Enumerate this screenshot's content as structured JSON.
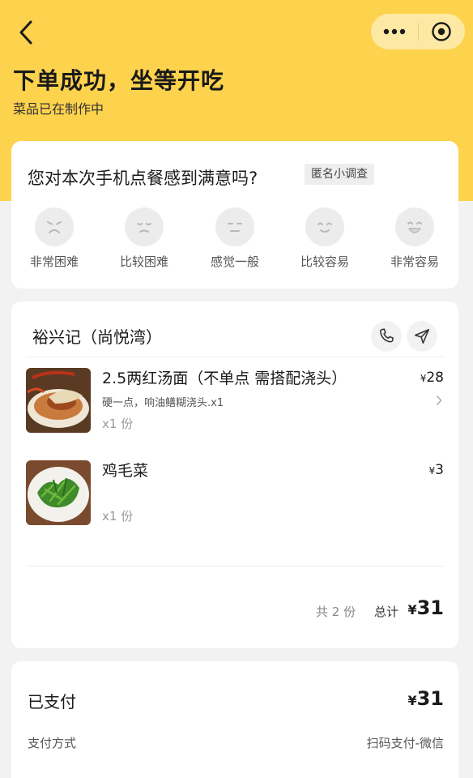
{
  "header": {
    "title": "下单成功，坐等开吃",
    "subtitle": "菜品已在制作中"
  },
  "survey": {
    "question": "您对本次手机点餐感到满意吗?",
    "tag": "匿名小调查",
    "options": [
      {
        "label": "非常困难",
        "icon": "very-unhappy-face-icon"
      },
      {
        "label": "比较困难",
        "icon": "unhappy-face-icon"
      },
      {
        "label": "感觉一般",
        "icon": "neutral-face-icon"
      },
      {
        "label": "比较容易",
        "icon": "happy-face-icon"
      },
      {
        "label": "非常容易",
        "icon": "very-happy-face-icon"
      }
    ]
  },
  "order": {
    "shop_name": "裕兴记（尚悦湾）",
    "items": [
      {
        "name": "2.5两红汤面（不单点 需搭配浇头）",
        "options": "硬一点，响油鳝糊浇头.x1",
        "qty": "x1 份",
        "currency": "¥",
        "price": "28"
      },
      {
        "name": "鸡毛菜",
        "options": "",
        "qty": "x1 份",
        "currency": "¥",
        "price": "3"
      }
    ],
    "count_text": "共 2 份",
    "total_label": "总计",
    "currency": "¥",
    "total": "31"
  },
  "payment": {
    "status": "已支付",
    "currency": "¥",
    "amount": "31",
    "method_label": "支付方式",
    "method_value": "扫码支付-微信"
  },
  "colors": {
    "header_bg": "#fdd24d",
    "capsule_bg": "#fde9a4",
    "page_bg": "#f2f2f2"
  }
}
